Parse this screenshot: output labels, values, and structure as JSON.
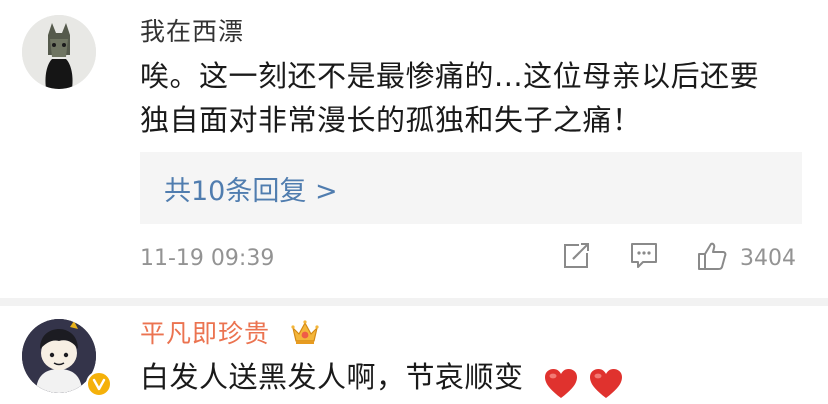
{
  "comments": [
    {
      "username": "我在西漂",
      "text_line1": "唉。这一刻还不是最惨痛的...这位母亲以后还要",
      "text_line2": "独自面对非常漫长的孤独和失子之痛！",
      "replies_label": "共10条回复 >",
      "time": "11-19 09:39",
      "like_count": "3404",
      "avatar_icon": "black-cat-avatar"
    },
    {
      "username": "平凡即珍贵",
      "text": "白发人送黑发人啊，节哀顺变",
      "badge_icon": "crown-badge-icon",
      "verified_icon": "verified-v-icon",
      "emoji": [
        "heart-emoji",
        "heart-emoji"
      ],
      "avatar_icon": "cartoon-character-avatar"
    }
  ],
  "colors": {
    "link": "#507daf",
    "vip_name": "#eb7350",
    "meta": "#939393",
    "heart": "#e0322e"
  }
}
